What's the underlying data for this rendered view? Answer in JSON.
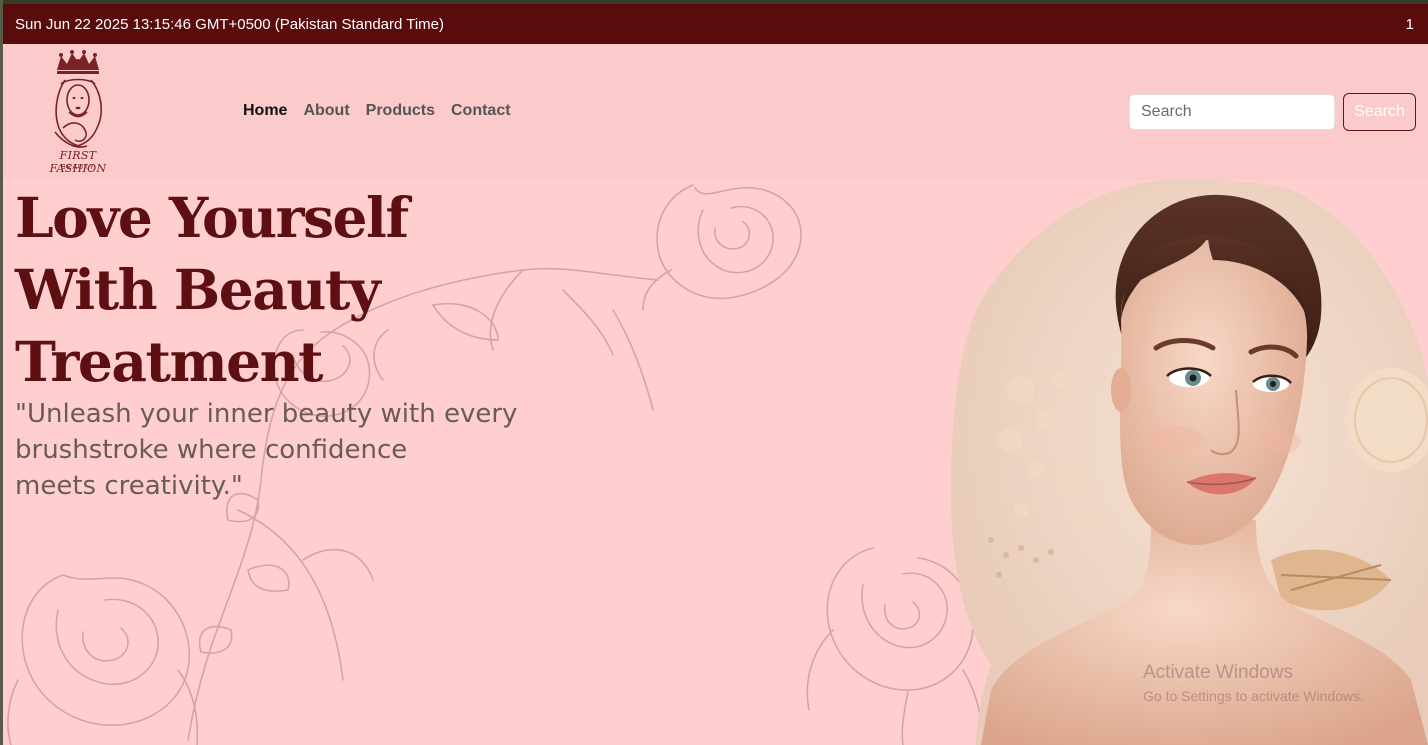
{
  "topbar": {
    "datetime": "Sun Jun 22 2025 13:15:46 GMT+0500 (Pakistan Standard Time)",
    "counter": "1"
  },
  "logo": {
    "name": "FIRST FASHION",
    "sub": "BEAUTY"
  },
  "nav": {
    "items": [
      {
        "label": "Home",
        "active": true
      },
      {
        "label": "About",
        "active": false
      },
      {
        "label": "Products",
        "active": false
      },
      {
        "label": "Contact",
        "active": false
      }
    ]
  },
  "search": {
    "placeholder": "Search",
    "button_label": "Search"
  },
  "hero": {
    "title_lines": [
      "Love Yourself",
      "With Beauty",
      "Treatment"
    ],
    "quote_lines": [
      "\"Unleash your inner beauty with every",
      "brushstroke where confidence",
      "meets creativity.\""
    ]
  },
  "watermark": {
    "title": "Activate Windows",
    "sub": "Go to Settings to activate Windows."
  },
  "colors": {
    "topbar": "#5a0c0c",
    "navbar": "#fbcaca",
    "hero_bg": "#ffcfcf",
    "title": "#5e0f12",
    "flower_line": "#d4a0a0"
  }
}
